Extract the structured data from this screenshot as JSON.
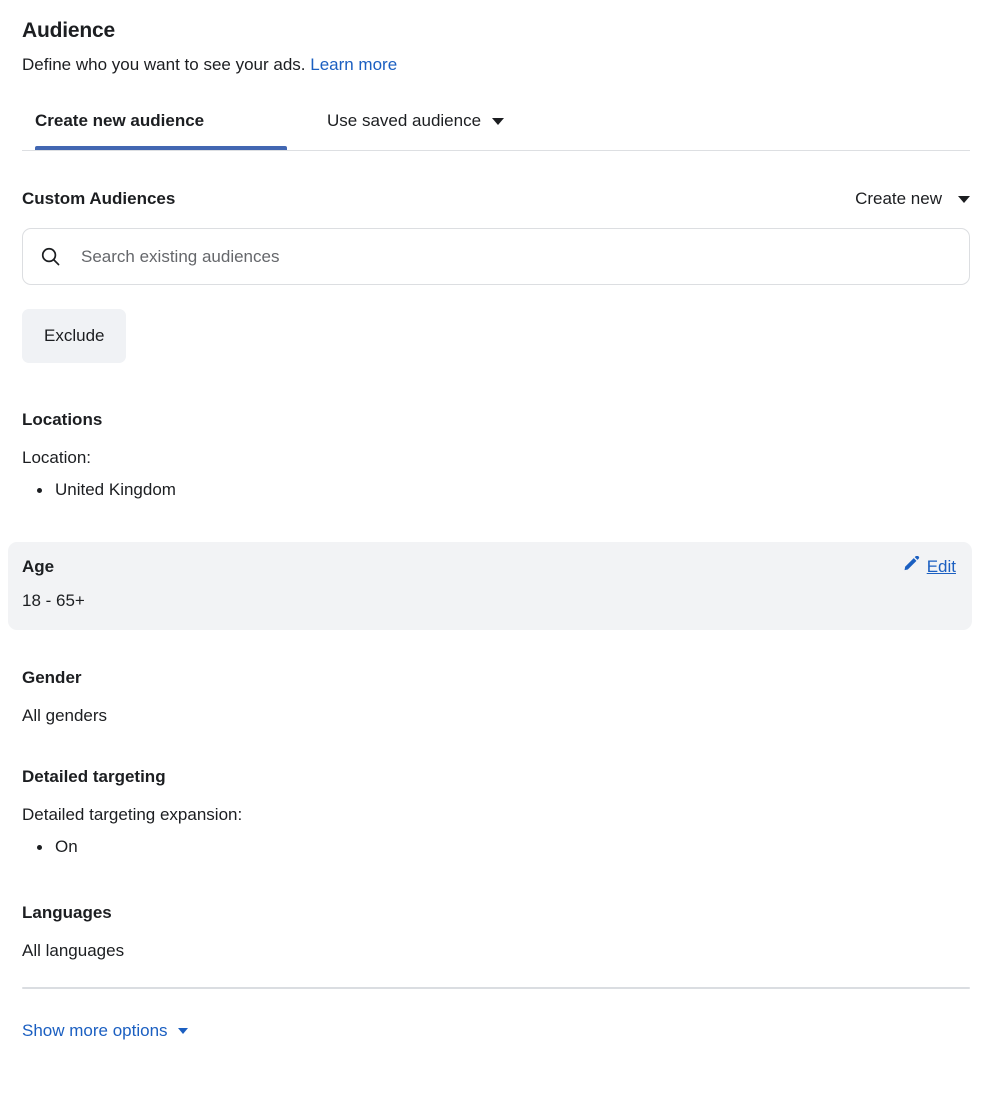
{
  "header": {
    "title": "Audience",
    "subtitle": "Define who you want to see your ads.",
    "learn_more": "Learn more"
  },
  "tabs": [
    {
      "label": "Create new audience",
      "active": true
    },
    {
      "label": "Use saved audience",
      "active": false,
      "icon": "chevron-down-icon"
    }
  ],
  "custom_audiences": {
    "label": "Custom Audiences",
    "create_new": "Create new",
    "create_new_icon": "chevron-down-icon",
    "search": {
      "placeholder": "Search existing audiences",
      "value": "",
      "icon": "search-icon"
    },
    "exclude_button": "Exclude"
  },
  "locations": {
    "title": "Locations",
    "field_label": "Location:",
    "items": [
      "United Kingdom"
    ]
  },
  "age": {
    "title": "Age",
    "value": "18 - 65+",
    "edit_label": "Edit",
    "edit_icon": "pencil-icon"
  },
  "gender": {
    "title": "Gender",
    "value": "All genders"
  },
  "detailed_targeting": {
    "title": "Detailed targeting",
    "field_label": "Detailed targeting expansion:",
    "items": [
      "On"
    ]
  },
  "languages": {
    "title": "Languages",
    "value": "All languages"
  },
  "footer": {
    "show_more_options": "Show more options",
    "show_more_icon": "caret-down-icon"
  },
  "colors": {
    "link_blue": "#1b5fc1",
    "tab_underline_blue": "#4267b2",
    "highlight_gray": "#f2f3f5",
    "button_gray": "#f0f2f5",
    "text_primary": "#1c1e21",
    "text_secondary": "#65676b",
    "border": "#dcdee1"
  }
}
